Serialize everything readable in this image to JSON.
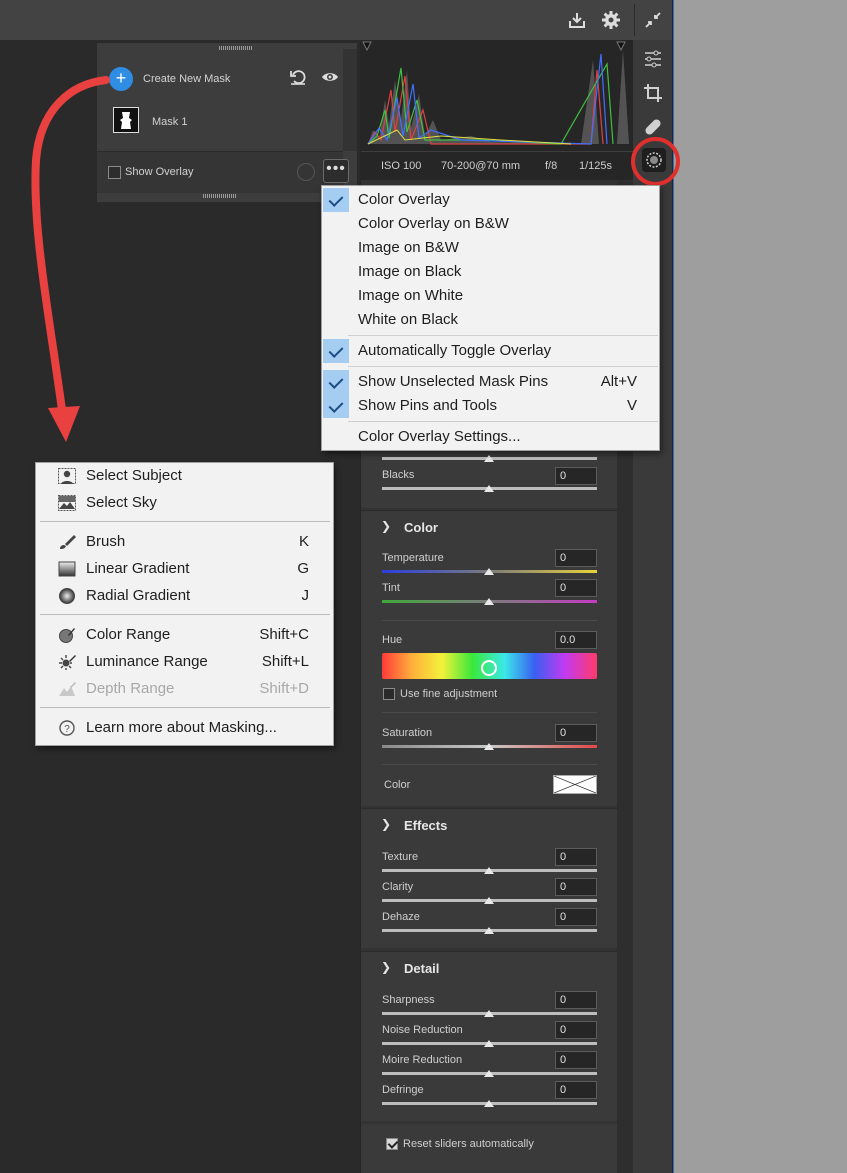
{
  "masks_panel": {
    "create_label": "Create New Mask",
    "mask1_label": "Mask 1",
    "show_overlay_label": "Show Overlay"
  },
  "camera_info": {
    "iso": "ISO 100",
    "lens": "70-200@70 mm",
    "aperture": "f/8",
    "shutter": "1/125s"
  },
  "overlay_menu": {
    "items": [
      {
        "label": "Color Overlay",
        "checked": true,
        "shortcut": ""
      },
      {
        "label": "Color Overlay on B&W",
        "checked": false,
        "shortcut": ""
      },
      {
        "label": "Image on B&W",
        "checked": false,
        "shortcut": ""
      },
      {
        "label": "Image on Black",
        "checked": false,
        "shortcut": ""
      },
      {
        "label": "Image on White",
        "checked": false,
        "shortcut": ""
      },
      {
        "label": "White on Black",
        "checked": false,
        "shortcut": ""
      },
      {
        "label": "Automatically Toggle Overlay",
        "checked": true,
        "shortcut": ""
      },
      {
        "label": "Show Unselected Mask Pins",
        "checked": true,
        "shortcut": "Alt+V"
      },
      {
        "label": "Show Pins and Tools",
        "checked": true,
        "shortcut": "V"
      },
      {
        "label": "Color Overlay Settings...",
        "checked": false,
        "shortcut": ""
      }
    ]
  },
  "mask_menu": {
    "items": [
      {
        "label": "Select Subject",
        "icon": "subject-icon",
        "shortcut": ""
      },
      {
        "label": "Select Sky",
        "icon": "sky-icon",
        "shortcut": ""
      },
      {
        "label": "Brush",
        "icon": "brush-icon",
        "shortcut": "K"
      },
      {
        "label": "Linear Gradient",
        "icon": "linear-gradient-icon",
        "shortcut": "G"
      },
      {
        "label": "Radial Gradient",
        "icon": "radial-gradient-icon",
        "shortcut": "J"
      },
      {
        "label": "Color Range",
        "icon": "color-range-icon",
        "shortcut": "Shift+C"
      },
      {
        "label": "Luminance Range",
        "icon": "luminance-range-icon",
        "shortcut": "Shift+L"
      },
      {
        "label": "Depth Range",
        "icon": "depth-range-icon",
        "shortcut": "Shift+D"
      },
      {
        "label": "Learn more about Masking...",
        "icon": "help-icon",
        "shortcut": ""
      }
    ]
  },
  "adjust": {
    "blacks": {
      "label": "Blacks",
      "value": "0"
    },
    "color_section": "Color",
    "temperature": {
      "label": "Temperature",
      "value": "0"
    },
    "tint": {
      "label": "Tint",
      "value": "0"
    },
    "hue": {
      "label": "Hue",
      "value": "0.0"
    },
    "fine_adjust_label": "Use fine adjustment",
    "saturation": {
      "label": "Saturation",
      "value": "0"
    },
    "color_label": "Color",
    "effects_section": "Effects",
    "texture": {
      "label": "Texture",
      "value": "0"
    },
    "clarity": {
      "label": "Clarity",
      "value": "0"
    },
    "dehaze": {
      "label": "Dehaze",
      "value": "0"
    },
    "detail_section": "Detail",
    "sharpness": {
      "label": "Sharpness",
      "value": "0"
    },
    "noise": {
      "label": "Noise Reduction",
      "value": "0"
    },
    "moire": {
      "label": "Moire Reduction",
      "value": "0"
    },
    "defringe": {
      "label": "Defringe",
      "value": "0"
    },
    "reset_label": "Reset sliders automatically"
  },
  "colors": {
    "accent_blue": "#2f8de4",
    "highlight_red": "#e0302e",
    "menu_check_bg": "#a5cdf2"
  }
}
